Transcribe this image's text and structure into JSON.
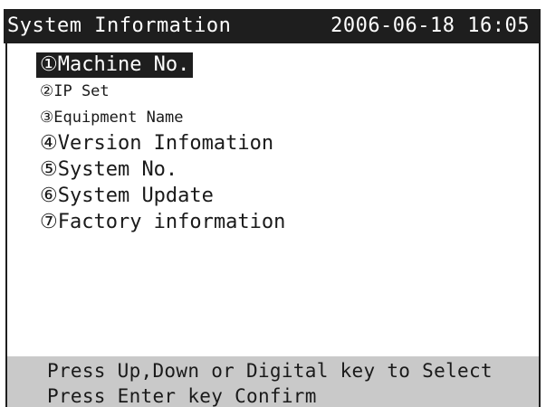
{
  "header": {
    "title": "System Information",
    "datetime": "2006-06-18 16:05"
  },
  "menu": {
    "selected_index": 0,
    "items": [
      {
        "label": "①Machine No."
      },
      {
        "label": "②IP Set"
      },
      {
        "label": "③Equipment Name"
      },
      {
        "label": "④Version Infomation"
      },
      {
        "label": "⑤System No."
      },
      {
        "label": "⑥System Update"
      },
      {
        "label": "⑦Factory information"
      }
    ]
  },
  "status": {
    "line1": "Press Up,Down or Digital key to  Select",
    "line2": "Press Enter key Confirm"
  },
  "colors": {
    "title_bg": "#1e1e1e",
    "title_fg": "#ffffff",
    "status_bg": "#c9c9c9",
    "selection_bg": "#1e1e1e"
  }
}
